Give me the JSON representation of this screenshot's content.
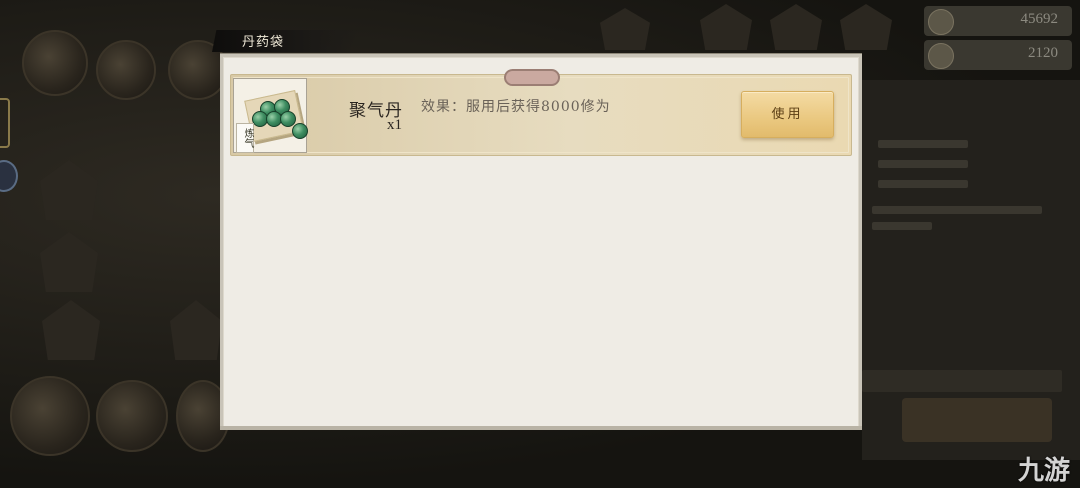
{
  "currency": [
    {
      "icon": "copper-coin-icon",
      "value": "45692"
    },
    {
      "icon": "spirit-stone-icon",
      "value": "2120"
    }
  ],
  "modal": {
    "title": "丹药袋",
    "items": [
      {
        "badge": "",
        "icon": "green-pills-icon",
        "tag": "炼气",
        "name": "聚气丹",
        "count": "x1",
        "effect": "效果：服用后获得8000修为",
        "action_label": "使用"
      }
    ]
  },
  "watermark": "九游",
  "colors": {
    "modal_bg": "#efece5",
    "item_row_bg": "#e7dcc0",
    "use_button": "#eac880",
    "title_bar": "#1c1a17"
  }
}
